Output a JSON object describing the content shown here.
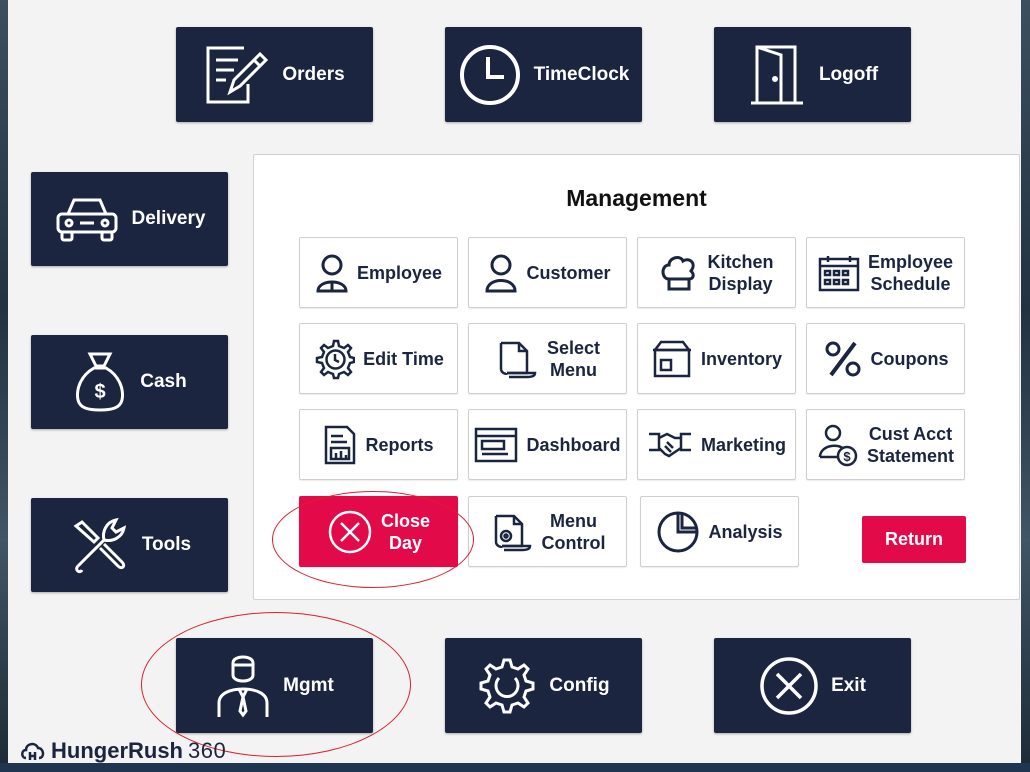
{
  "top_buttons": {
    "orders": "Orders",
    "timeclock": "TimeClock",
    "logoff": "Logoff"
  },
  "side_buttons": {
    "delivery": "Delivery",
    "cash": "Cash",
    "tools": "Tools"
  },
  "bottom_buttons": {
    "mgmt": "Mgmt",
    "config": "Config",
    "exit": "Exit"
  },
  "management": {
    "title": "Management",
    "employee": "Employee",
    "customer": "Customer",
    "kitchen_display_1": "Kitchen",
    "kitchen_display_2": "Display",
    "employee_schedule_1": "Employee",
    "employee_schedule_2": "Schedule",
    "edit_time": "Edit Time",
    "select_menu_1": "Select",
    "select_menu_2": "Menu",
    "inventory": "Inventory",
    "coupons": "Coupons",
    "reports": "Reports",
    "dashboard": "Dashboard",
    "marketing": "Marketing",
    "cust_acct_1": "Cust Acct",
    "cust_acct_2": "Statement",
    "close_day_1": "Close",
    "close_day_2": "Day",
    "menu_control_1": "Menu",
    "menu_control_2": "Control",
    "analysis": "Analysis",
    "return": "Return"
  },
  "logo": {
    "brand": "HungerRush",
    "number": "360"
  },
  "colors": {
    "navy": "#1b2540",
    "accent_red": "#e30a4a",
    "annotation_red": "#d9212b"
  }
}
